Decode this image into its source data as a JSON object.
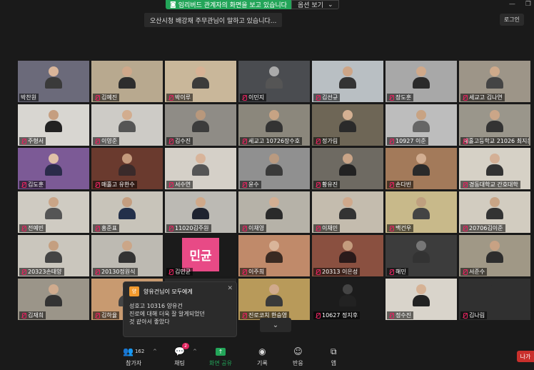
{
  "banner": {
    "status": "임리버드 관계자의 화면을 보고 있습니다",
    "options": "옵션 보기"
  },
  "speaker_tip": "오산시청 배강채 주무관님이 말하고 있습니다...",
  "login": "로그인",
  "participants": [
    {
      "name": "박찬원",
      "bg": "#6b6a7a",
      "skin": "#d9b59a",
      "shirt": "#3a3a3a",
      "mic": false
    },
    {
      "name": "김예진",
      "bg": "#b8a98f",
      "skin": "#cfa88a",
      "shirt": "#2d2d2d",
      "mic": true
    },
    {
      "name": "박이루",
      "bg": "#c9b79a",
      "skin": "#d7b295",
      "shirt": "#3b3b3b",
      "mic": true
    },
    {
      "name": "이민지",
      "bg": "#4a4c50",
      "skin": "#aaa",
      "shirt": "#555",
      "mic": true
    },
    {
      "name": "김선규",
      "bg": "#b9bfc3",
      "skin": "#cda587",
      "shirt": "#333",
      "mic": true
    },
    {
      "name": "장도훈",
      "bg": "#a8a8a8",
      "skin": "#d0a98a",
      "shirt": "#2a2a2a",
      "mic": true
    },
    {
      "name": "세교고 김나연",
      "bg": "#9d9588",
      "skin": "#cfaa8b",
      "shirt": "#444",
      "mic": true
    },
    {
      "name": "주형서",
      "bg": "#d8d6d1",
      "skin": "#c59e80",
      "shirt": "#222",
      "mic": true
    },
    {
      "name": "이영준",
      "bg": "#cdcbc6",
      "skin": "#d2ad8f",
      "shirt": "#555",
      "mic": true
    },
    {
      "name": "김수진",
      "bg": "#8f8c86",
      "skin": "#b8987c",
      "shirt": "#3c3c3c",
      "mic": true
    },
    {
      "name": "세교고 10726장수호",
      "bg": "#8b877c",
      "skin": "#c7a384",
      "shirt": "#333",
      "mic": true
    },
    {
      "name": "정가림",
      "bg": "#6e6656",
      "skin": "#d4b092",
      "shirt": "#2a2a2a",
      "mic": true
    },
    {
      "name": "10927 이준",
      "bg": "#bdbdbd",
      "skin": "#c8a383",
      "shirt": "#666",
      "mic": true
    },
    {
      "name": "매홀고등학교 21026 최지운",
      "bg": "#9a968b",
      "skin": "#cba688",
      "shirt": "#333",
      "mic": true
    },
    {
      "name": "김도훈",
      "bg": "#7c5a96",
      "skin": "#e0c0a8",
      "shirt": "#2b2b4a",
      "mic": true
    },
    {
      "name": "매홀고 유한수",
      "bg": "#6a3a2e",
      "skin": "#c49a7d",
      "shirt": "#3a2a2a",
      "mic": true
    },
    {
      "name": "서수연",
      "bg": "#d5d0c8",
      "skin": "#d8b49a",
      "shirt": "#555",
      "mic": true
    },
    {
      "name": "윤수",
      "bg": "#909090",
      "skin": "#b99a80",
      "shirt": "#3a3a3a",
      "mic": true
    },
    {
      "name": "황유진",
      "bg": "#6e6a62",
      "skin": "#c9a487",
      "shirt": "#222",
      "mic": true
    },
    {
      "name": "손다빈",
      "bg": "#a37a5a",
      "skin": "#d2ae92",
      "shirt": "#2a2a2a",
      "mic": true
    },
    {
      "name": "경동대학교 간호대학",
      "bg": "#d6d1c6",
      "skin": "#d4b096",
      "shirt": "#333",
      "mic": true
    },
    {
      "name": "전예빈",
      "bg": "#cfcbc2",
      "skin": "#caa587",
      "shirt": "#555",
      "mic": true
    },
    {
      "name": "홍준표",
      "bg": "#c8c4ba",
      "skin": "#c49e80",
      "shirt": "#23304a",
      "mic": true
    },
    {
      "name": "11020김주원",
      "bg": "#bcbab4",
      "skin": "#cfa98a",
      "shirt": "#1e2330",
      "mic": true
    },
    {
      "name": "이채영",
      "bg": "#b6b2a8",
      "skin": "#d3ae92",
      "shirt": "#2a2a2a",
      "mic": true
    },
    {
      "name": "이채민",
      "bg": "#c4bcae",
      "skin": "#d0a98c",
      "shirt": "#333",
      "mic": true
    },
    {
      "name": "백건우",
      "bg": "#c8b98a",
      "skin": "#bfa07f",
      "shirt": "#444",
      "mic": true
    },
    {
      "name": "20706김이준",
      "bg": "#d2ccc0",
      "skin": "#c9a586",
      "shirt": "#333",
      "mic": true
    },
    {
      "name": "20323손태양",
      "bg": "#cac6bd",
      "skin": "#c49f80",
      "shirt": "#444",
      "mic": true
    },
    {
      "name": "20130정원식",
      "bg": "#bdbab2",
      "skin": "#cba688",
      "shirt": "#333",
      "mic": true
    },
    {
      "name": "김민균",
      "bg": "#1b1b1b",
      "skin": "#000",
      "shirt": "#000",
      "mic": true,
      "tag": "민균"
    },
    {
      "name": "이주희",
      "bg": "#c08a6a",
      "skin": "#d9b59a",
      "shirt": "#3a2a22",
      "mic": true
    },
    {
      "name": "20313 이은성",
      "bg": "#8a5040",
      "skin": "#c49c7e",
      "shirt": "#2a1a1a",
      "mic": true
    },
    {
      "name": "해민",
      "bg": "#3c3c3c",
      "skin": "#777",
      "shirt": "#333",
      "mic": true
    },
    {
      "name": "서준수",
      "bg": "#a09886",
      "skin": "#c8a284",
      "shirt": "#2d2d2d",
      "mic": true
    },
    {
      "name": "김재희",
      "bg": "#9b9589",
      "skin": "#d0ab8e",
      "shirt": "#333",
      "mic": true
    },
    {
      "name": "김하율",
      "bg": "#c89a70",
      "skin": "#d6b193",
      "shirt": "#444",
      "mic": true
    },
    {
      "name": "",
      "bg": "#2a2a2a",
      "skin": "#2a2a2a",
      "shirt": "#2a2a2a",
      "mic": false
    },
    {
      "name": "진로코치 한승영",
      "bg": "#b89a5a",
      "skin": "#d0aa8c",
      "shirt": "#3a3a3a",
      "mic": true
    },
    {
      "name": "10627 정지후",
      "bg": "#1c1c1c",
      "skin": "#444",
      "shirt": "#222",
      "mic": true
    },
    {
      "name": "정수진",
      "bg": "#d9d4cb",
      "skin": "#d6b295",
      "shirt": "#222",
      "mic": true
    },
    {
      "name": "김나림",
      "bg": "#303030",
      "skin": "#303030",
      "shirt": "#303030",
      "mic": true
    }
  ],
  "chat_popup": {
    "avatar_char": "양",
    "title": "양유건님이 모두에게",
    "line1": "성호고 10316 양유건",
    "line2": "진로에 대해 더욱 잘 알게되었던",
    "line3": "것 같아서 좋았다"
  },
  "toolbar": {
    "participants_label": "참가자",
    "participants_count": "162",
    "chat_label": "채팅",
    "chat_badge": "2",
    "share_label": "화면 공유",
    "record_label": "기록",
    "reactions_label": "반응",
    "apps_label": "앱",
    "leave_label": "나가"
  }
}
